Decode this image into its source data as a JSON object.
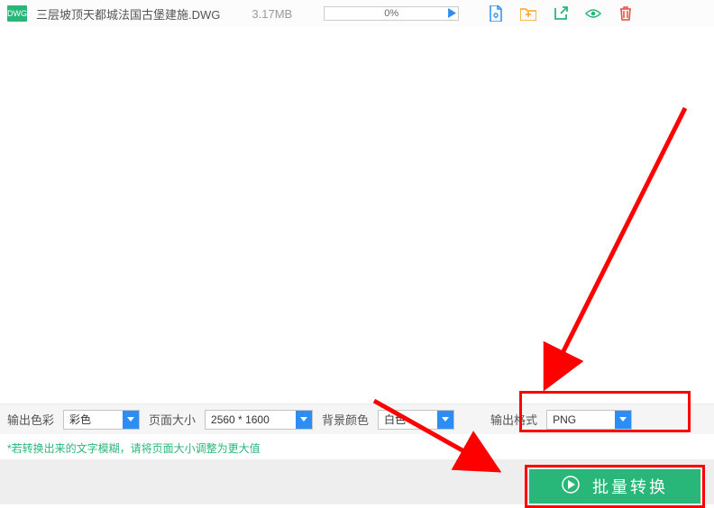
{
  "file": {
    "badge": "DWG",
    "name": "三层坡顶天都城法国古堡建施.DWG",
    "size": "3.17MB",
    "progress": "0%"
  },
  "options": {
    "color_label": "输出色彩",
    "color_value": "彩色",
    "page_label": "页面大小",
    "page_value": "2560 * 1600",
    "bg_label": "背景颜色",
    "bg_value": "白色",
    "fmt_label": "输出格式",
    "fmt_value": "PNG"
  },
  "hint": "*若转换出来的文字模糊，请将页面大小调整为更大值",
  "convert_label": "批量转换"
}
